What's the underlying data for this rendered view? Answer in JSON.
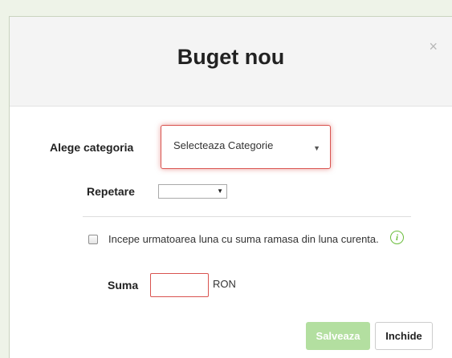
{
  "modal": {
    "title": "Buget nou",
    "close_symbol": "×"
  },
  "form": {
    "category_label": "Alege categoria",
    "category_selected": "Selecteaza Categorie",
    "repeat_label": "Repetare",
    "repeat_selected": "",
    "rollover_checked": false,
    "rollover_text": "Incepe urmatoarea luna cu suma ramasa din luna curenta.",
    "info_glyph": "i",
    "amount_label": "Suma",
    "amount_value": "",
    "currency": "RON"
  },
  "buttons": {
    "save_label": "Salveaza",
    "close_label": "Inchide"
  },
  "colors": {
    "accent_green": "#6bbd3c",
    "save_disabled": "#b3dfa0",
    "error_border": "#d9534f"
  },
  "icons": {
    "close": "close-icon",
    "info": "info-icon",
    "dropdown": "chevron-down-icon"
  }
}
